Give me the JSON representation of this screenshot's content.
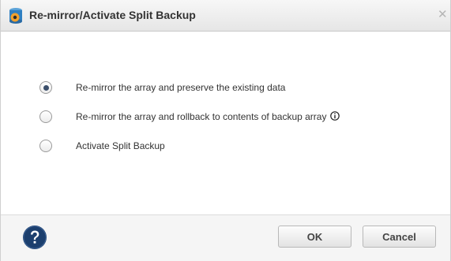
{
  "dialog": {
    "title": "Re-mirror/Activate Split Backup",
    "close_label": "✕"
  },
  "options": [
    {
      "label": "Re-mirror the array and preserve the existing data",
      "selected": true
    },
    {
      "label": "Re-mirror the array and rollback to contents of backup array",
      "selected": false
    },
    {
      "label": "Activate Split Backup",
      "selected": false
    }
  ],
  "footer": {
    "ok_label": "OK",
    "cancel_label": "Cancel"
  },
  "icons": {
    "app": "app-icon",
    "close": "close-icon",
    "info": "info-icon",
    "help": "help-icon"
  },
  "colors": {
    "help": "#1c3f6e",
    "radio_selected": "#3b4f6b",
    "app_icon_blue": "#2f7fc1",
    "app_icon_orange": "#f2a12d"
  }
}
